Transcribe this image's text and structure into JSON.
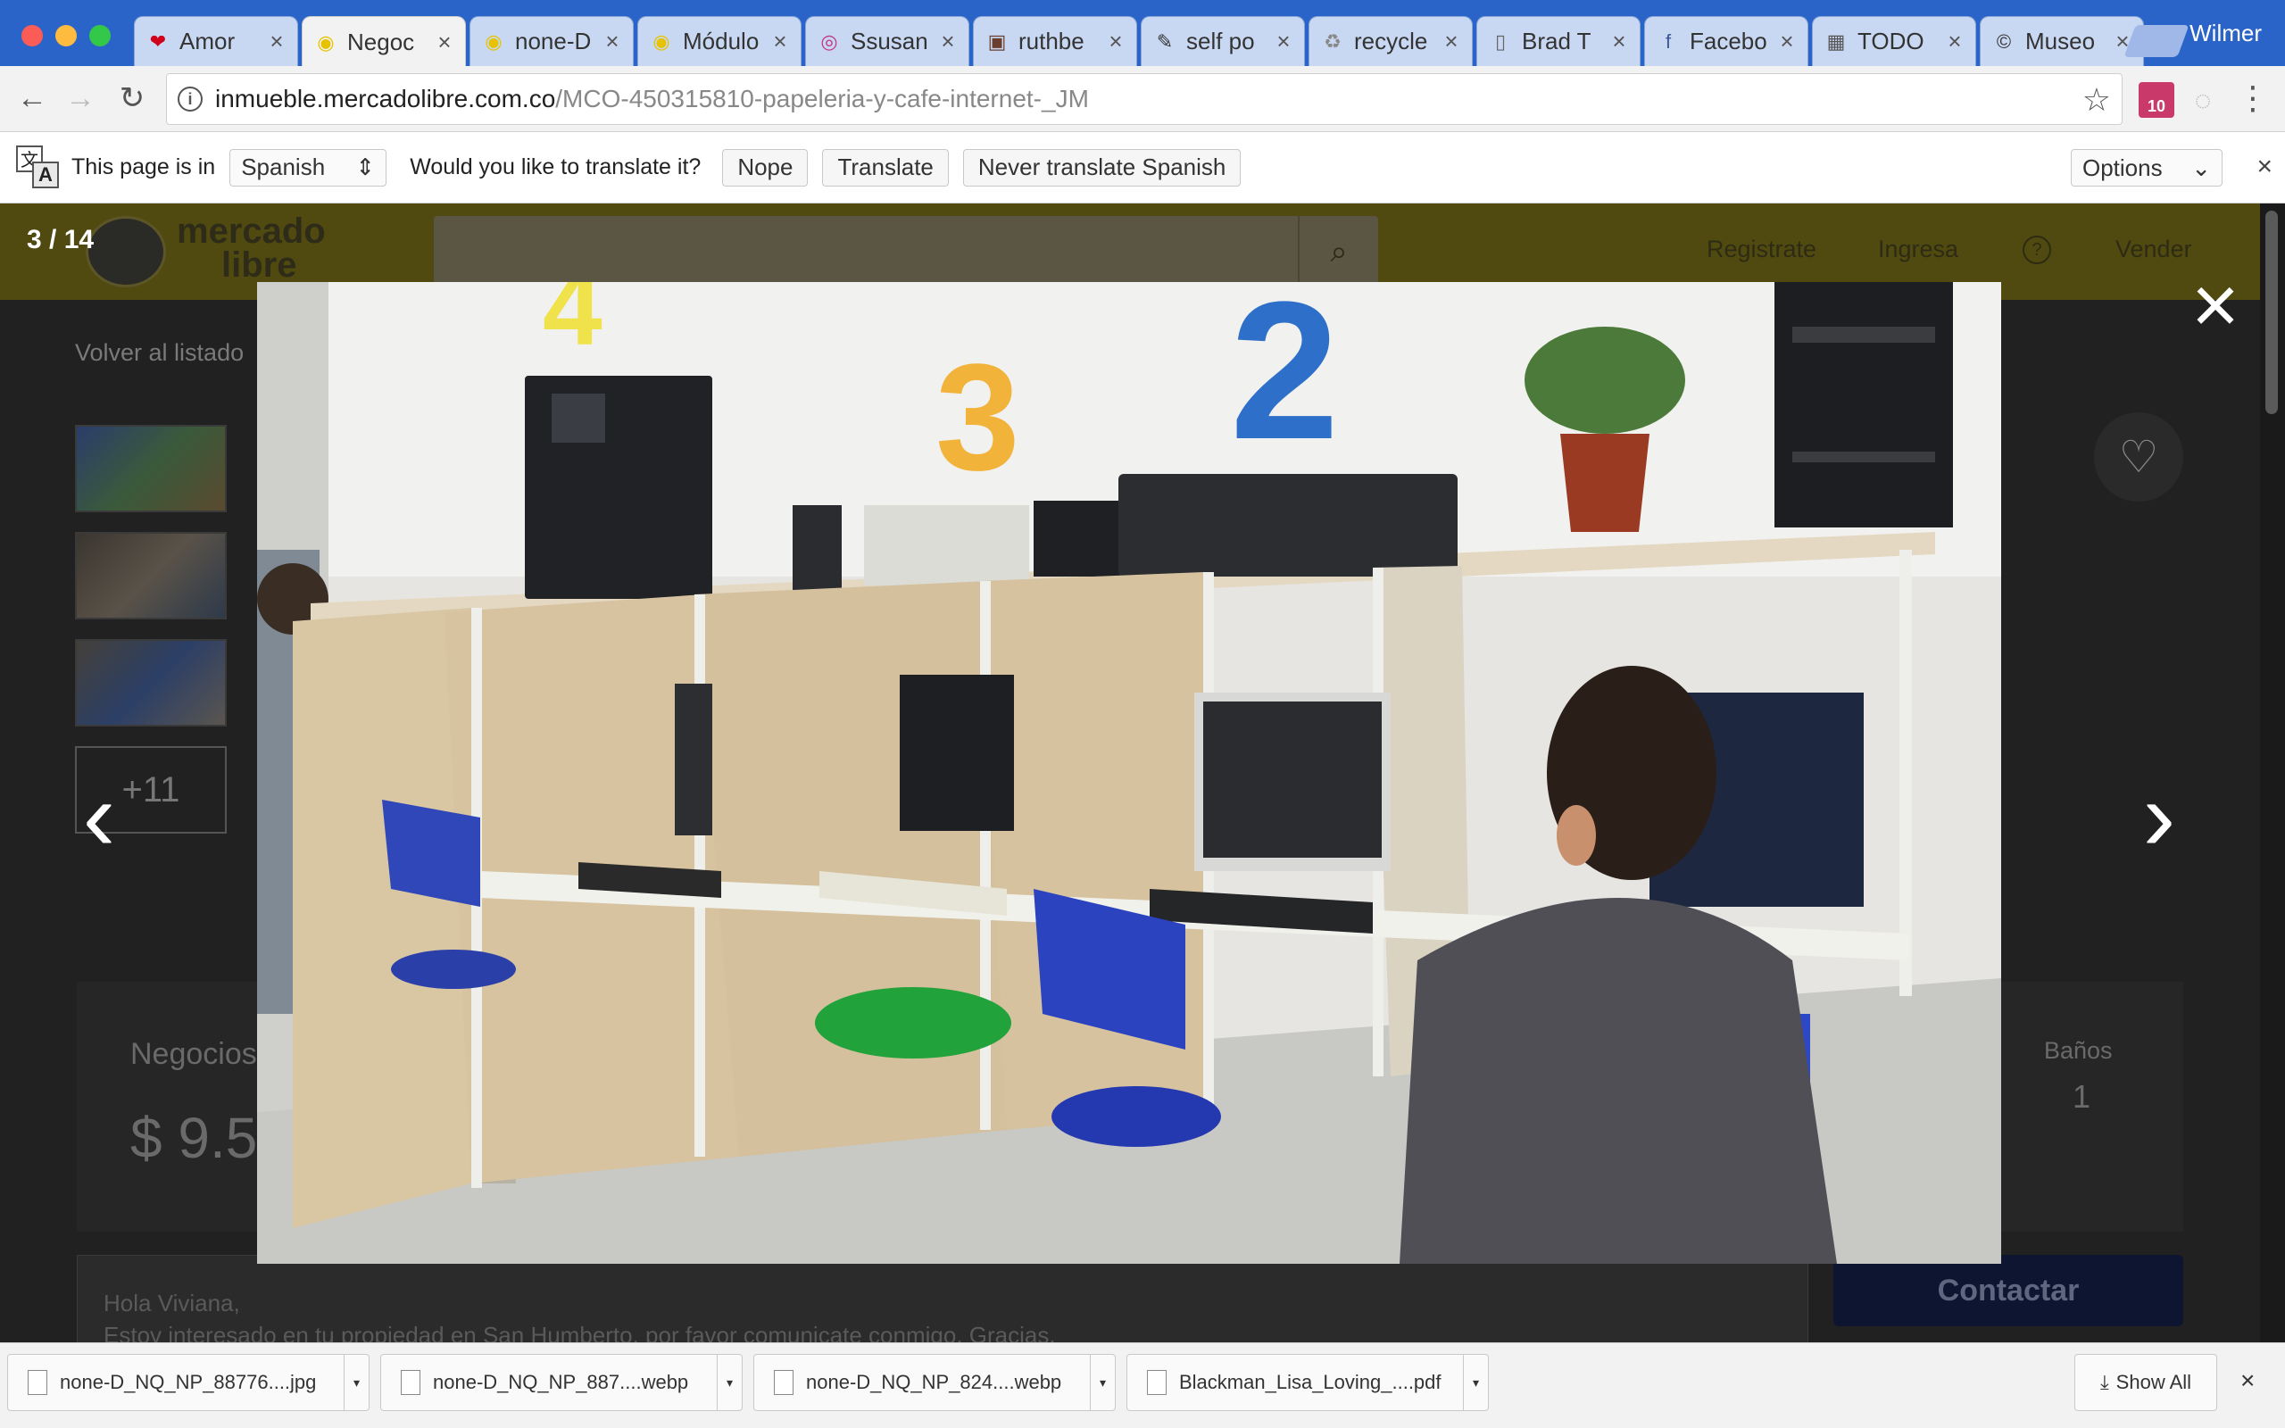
{
  "tabs": [
    {
      "title": "Amor",
      "icon": "heart-icon",
      "glyph": "❤",
      "color": "#d0021b"
    },
    {
      "title": "Negoc",
      "icon": "mercadolibre-icon",
      "glyph": "◉",
      "color": "#e6c200"
    },
    {
      "title": "none-D",
      "icon": "mercadolibre-icon",
      "glyph": "◉",
      "color": "#e6c200"
    },
    {
      "title": "Módulo",
      "icon": "mercadolibre-icon",
      "glyph": "◉",
      "color": "#e6c200"
    },
    {
      "title": "Ssusan",
      "icon": "instagram-icon",
      "glyph": "◎",
      "color": "#c13584"
    },
    {
      "title": "ruthbe",
      "icon": "image-thumb-icon",
      "glyph": "▣",
      "color": "#6b3e2e"
    },
    {
      "title": "self po",
      "icon": "image-thumb-icon",
      "glyph": "✎",
      "color": "#333333"
    },
    {
      "title": "recycle",
      "icon": "image-thumb-icon",
      "glyph": "♻",
      "color": "#888888"
    },
    {
      "title": "Brad T",
      "icon": "document-icon",
      "glyph": "▯",
      "color": "#666666"
    },
    {
      "title": "Facebo",
      "icon": "facebook-icon",
      "glyph": "f",
      "color": "#3b5998"
    },
    {
      "title": "TODO",
      "icon": "image-thumb-icon",
      "glyph": "▦",
      "color": "#555555"
    },
    {
      "title": "Museo",
      "icon": "copyright-icon",
      "glyph": "©",
      "color": "#333333"
    }
  ],
  "active_tab_index": 1,
  "profile_name": "Wilmer",
  "address": {
    "domain": "inmueble.mercadolibre.com.co",
    "path": "/MCO-450315810-papeleria-y-cafe-internet-_JM"
  },
  "extension_badge": "10",
  "translate_bar": {
    "prefix": "This page is in",
    "language": "Spanish",
    "question": "Would you like to translate it?",
    "nope": "Nope",
    "translate": "Translate",
    "never": "Never translate Spanish",
    "options": "Options"
  },
  "page": {
    "counter": "3 / 14",
    "brand_line1": "mercado",
    "brand_line2": "libre",
    "nav_register": "Registrate",
    "nav_login": "Ingresa",
    "nav_help": "?",
    "nav_sell": "Vender",
    "back_link": "Volver al listado",
    "more_photos": "+11",
    "listing_title": "Negocios",
    "listing_price": "$ 9.5",
    "baths_label": "Baños",
    "baths_value": "1",
    "message_line1": "Hola Viviana,",
    "message_line2": "Estoy interesado en tu propiedad en San Humberto, por favor comunicate conmigo. Gracias.",
    "contact_button": "Contactar"
  },
  "lightbox": {
    "close_label": "×",
    "prev_label": "‹",
    "next_label": "›",
    "cubicle_numbers": [
      "4",
      "3",
      "2"
    ]
  },
  "downloads": [
    {
      "name": "none-D_NQ_NP_88776....jpg"
    },
    {
      "name": "none-D_NQ_NP_887....webp"
    },
    {
      "name": "none-D_NQ_NP_824....webp"
    },
    {
      "name": "Blackman_Lisa_Loving_....pdf"
    }
  ],
  "download_show_all": "Show All",
  "colors": {
    "chrome_blue": "#2a64c9",
    "ml_yellow": "#fff159",
    "contact_blue": "#3483fa"
  }
}
